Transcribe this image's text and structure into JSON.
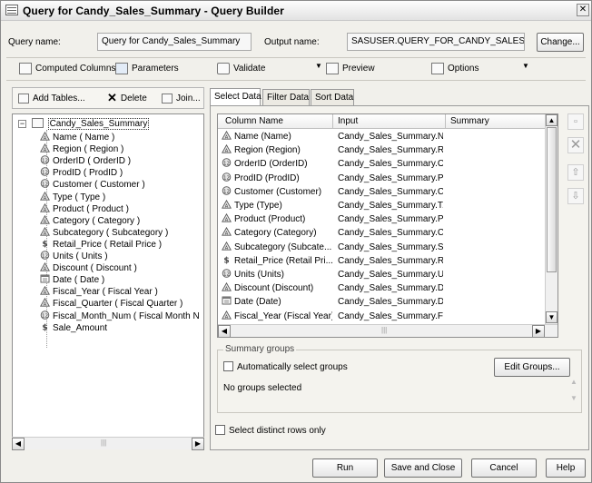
{
  "window": {
    "title": "Query for Candy_Sales_Summary - Query Builder"
  },
  "header": {
    "query_name_label": "Query name:",
    "query_name_value": "Query for Candy_Sales_Summary",
    "output_name_label": "Output name:",
    "output_name_value": "SASUSER.QUERY_FOR_CANDY_SALES_S",
    "change_button": "Change..."
  },
  "toolbar": {
    "computed_columns": "Computed Columns",
    "parameters": "Parameters",
    "validate": "Validate",
    "preview": "Preview",
    "options": "Options"
  },
  "left_toolbar": {
    "add_tables": "Add Tables...",
    "delete": "Delete",
    "join": "Join..."
  },
  "tree": {
    "root": "Candy_Sales_Summary",
    "items": [
      {
        "label": "Name ( Name )",
        "icon": "char-column-icon"
      },
      {
        "label": "Region ( Region )",
        "icon": "char-column-icon"
      },
      {
        "label": "OrderID ( OrderID )",
        "icon": "numeric-column-icon"
      },
      {
        "label": "ProdID ( ProdID )",
        "icon": "numeric-column-icon"
      },
      {
        "label": "Customer ( Customer )",
        "icon": "numeric-column-icon"
      },
      {
        "label": "Type ( Type )",
        "icon": "char-column-icon"
      },
      {
        "label": "Product ( Product )",
        "icon": "char-column-icon"
      },
      {
        "label": "Category ( Category )",
        "icon": "char-column-icon"
      },
      {
        "label": "Subcategory ( Subcategory )",
        "icon": "char-column-icon"
      },
      {
        "label": "Retail_Price ( Retail Price )",
        "icon": "currency-column-icon"
      },
      {
        "label": "Units ( Units )",
        "icon": "numeric-column-icon"
      },
      {
        "label": "Discount ( Discount )",
        "icon": "char-column-icon"
      },
      {
        "label": "Date ( Date )",
        "icon": "date-column-icon"
      },
      {
        "label": "Fiscal_Year ( Fiscal Year )",
        "icon": "char-column-icon"
      },
      {
        "label": "Fiscal_Quarter ( Fiscal Quarter )",
        "icon": "char-column-icon"
      },
      {
        "label": "Fiscal_Month_Num ( Fiscal Month N",
        "icon": "numeric-column-icon"
      },
      {
        "label": "Sale_Amount",
        "icon": "currency-column-icon"
      }
    ]
  },
  "tabs": [
    "Select Data",
    "Filter Data",
    "Sort Data"
  ],
  "grid": {
    "headers": [
      "Column Name",
      "Input",
      "Summary"
    ],
    "rows": [
      {
        "name": "Name (Name)",
        "input": "Candy_Sales_Summary.N...",
        "icon": "char-column-icon"
      },
      {
        "name": "Region (Region)",
        "input": "Candy_Sales_Summary.R...",
        "icon": "char-column-icon"
      },
      {
        "name": "OrderID (OrderID)",
        "input": "Candy_Sales_Summary.O...",
        "icon": "numeric-column-icon"
      },
      {
        "name": "ProdID (ProdID)",
        "input": "Candy_Sales_Summary.P...",
        "icon": "numeric-column-icon"
      },
      {
        "name": "Customer (Customer)",
        "input": "Candy_Sales_Summary.C...",
        "icon": "numeric-column-icon"
      },
      {
        "name": "Type (Type)",
        "input": "Candy_Sales_Summary.T...",
        "icon": "char-column-icon"
      },
      {
        "name": "Product (Product)",
        "input": "Candy_Sales_Summary.P...",
        "icon": "char-column-icon"
      },
      {
        "name": "Category (Category)",
        "input": "Candy_Sales_Summary.C...",
        "icon": "char-column-icon"
      },
      {
        "name": "Subcategory (Subcate...",
        "input": "Candy_Sales_Summary.S...",
        "icon": "char-column-icon"
      },
      {
        "name": "Retail_Price (Retail Pri...",
        "input": "Candy_Sales_Summary.R...",
        "icon": "currency-column-icon"
      },
      {
        "name": "Units (Units)",
        "input": "Candy_Sales_Summary.U...",
        "icon": "numeric-column-icon"
      },
      {
        "name": "Discount (Discount)",
        "input": "Candy_Sales_Summary.D...",
        "icon": "char-column-icon"
      },
      {
        "name": "Date (Date)",
        "input": "Candy_Sales_Summary.D...",
        "icon": "date-column-icon"
      },
      {
        "name": "Fiscal_Year (Fiscal Year)",
        "input": "Candy_Sales_Summary.Fi...",
        "icon": "char-column-icon"
      }
    ]
  },
  "summary_groups": {
    "legend": "Summary groups",
    "auto_select_label": "Automatically select groups",
    "edit_groups_button": "Edit Groups...",
    "status_text": "No groups selected"
  },
  "distinct_rows_label": "Select distinct rows only",
  "footer": {
    "run": "Run",
    "save_close": "Save and Close",
    "cancel": "Cancel",
    "help": "Help"
  }
}
